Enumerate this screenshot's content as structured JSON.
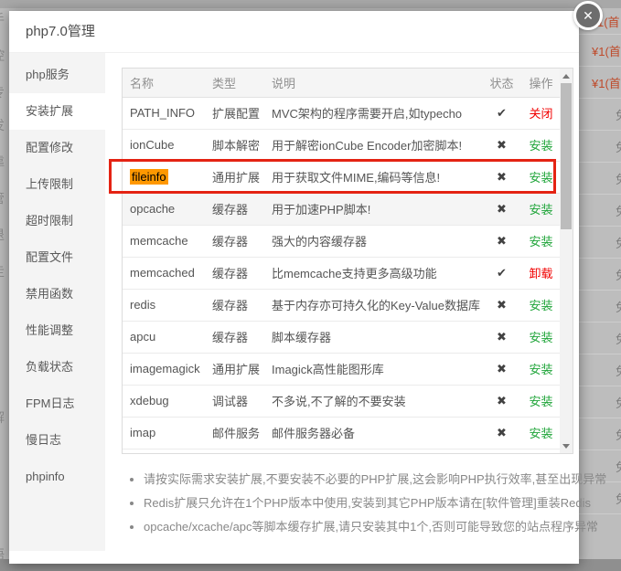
{
  "modal": {
    "title": "php7.0管理"
  },
  "close_button": {
    "icon": "✕"
  },
  "sidebar": {
    "items": [
      {
        "label": "php服务",
        "selected": false
      },
      {
        "label": "安装扩展",
        "selected": true
      },
      {
        "label": "配置修改",
        "selected": false
      },
      {
        "label": "上传限制",
        "selected": false
      },
      {
        "label": "超时限制",
        "selected": false
      },
      {
        "label": "配置文件",
        "selected": false
      },
      {
        "label": "禁用函数",
        "selected": false
      },
      {
        "label": "性能调整",
        "selected": false
      },
      {
        "label": "负载状态",
        "selected": false
      },
      {
        "label": "FPM日志",
        "selected": false
      },
      {
        "label": "慢日志",
        "selected": false
      },
      {
        "label": "phpinfo",
        "selected": false
      }
    ]
  },
  "table": {
    "headers": [
      "名称",
      "类型",
      "说明",
      "状态",
      "操作"
    ],
    "status_icons": {
      "installed": "✔",
      "not_installed": "✖"
    },
    "rows": [
      {
        "name": "PATH_INFO",
        "type": "扩展配置",
        "desc": "MVC架构的程序需要开启,如typecho",
        "status": "installed",
        "action": "关闭",
        "action_type": "danger",
        "highlighted": false,
        "shaded": false
      },
      {
        "name": "ionCube",
        "type": "脚本解密",
        "desc": "用于解密ionCube Encoder加密脚本!",
        "status": "not_installed",
        "action": "安装",
        "action_type": "primary",
        "highlighted": false,
        "shaded": false
      },
      {
        "name": "fileinfo",
        "type": "通用扩展",
        "desc": "用于获取文件MIME,编码等信息!",
        "status": "not_installed",
        "action": "安装",
        "action_type": "primary",
        "highlighted": true,
        "shaded": false
      },
      {
        "name": "opcache",
        "type": "缓存器",
        "desc": "用于加速PHP脚本!",
        "status": "not_installed",
        "action": "安装",
        "action_type": "primary",
        "highlighted": false,
        "shaded": true
      },
      {
        "name": "memcache",
        "type": "缓存器",
        "desc": "强大的内容缓存器",
        "status": "not_installed",
        "action": "安装",
        "action_type": "primary",
        "highlighted": false,
        "shaded": false
      },
      {
        "name": "memcached",
        "type": "缓存器",
        "desc": "比memcache支持更多高级功能",
        "status": "installed",
        "action": "卸载",
        "action_type": "danger",
        "highlighted": false,
        "shaded": false
      },
      {
        "name": "redis",
        "type": "缓存器",
        "desc": "基于内存亦可持久化的Key-Value数据库",
        "status": "not_installed",
        "action": "安装",
        "action_type": "primary",
        "highlighted": false,
        "shaded": false
      },
      {
        "name": "apcu",
        "type": "缓存器",
        "desc": "脚本缓存器",
        "status": "not_installed",
        "action": "安装",
        "action_type": "primary",
        "highlighted": false,
        "shaded": false
      },
      {
        "name": "imagemagick",
        "type": "通用扩展",
        "desc": "Imagick高性能图形库",
        "status": "not_installed",
        "action": "安装",
        "action_type": "primary",
        "highlighted": false,
        "shaded": false
      },
      {
        "name": "xdebug",
        "type": "调试器",
        "desc": "不多说,不了解的不要安装",
        "status": "not_installed",
        "action": "安装",
        "action_type": "primary",
        "highlighted": false,
        "shaded": false
      },
      {
        "name": "imap",
        "type": "邮件服务",
        "desc": "邮件服务器必备",
        "status": "not_installed",
        "action": "安装",
        "action_type": "primary",
        "highlighted": false,
        "shaded": false
      }
    ]
  },
  "notes": [
    "请按实际需求安装扩展,不要安装不必要的PHP扩展,这会影响PHP执行效率,甚至出现异常",
    "Redis扩展只允许在1个PHP版本中使用,安装到其它PHP版本请在[软件管理]重装Redis",
    "opcache/xcache/apc等脚本缓存扩展,请只安装其中1个,否则可能导致您的站点程序异常"
  ],
  "background": {
    "prices": [
      "1(首",
      "¥1(首",
      "¥1(首"
    ],
    "partial_glyph": "免",
    "partial_rows": 13,
    "left_glyphs": [
      "手",
      "控",
      "专",
      "发",
      "靠",
      "管",
      "退",
      "走",
      "d",
      "解",
      "N",
      "语"
    ]
  },
  "colors": {
    "green": "#20a53a",
    "red": "#f10000",
    "highlight_bg": "#ff9800",
    "annotation_red": "#e42313",
    "price_red": "#bf4a2a"
  }
}
